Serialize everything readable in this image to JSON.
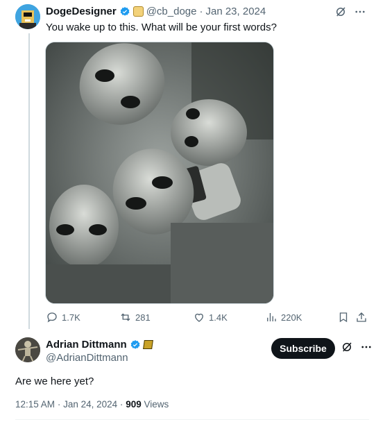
{
  "tweet1": {
    "display_name": "DogeDesigner",
    "handle": "@cb_doge",
    "separator": "·",
    "date": "Jan 23, 2024",
    "text": "You wake up to this. What will be your first words?",
    "stats": {
      "replies": "1.7K",
      "reposts": "281",
      "likes": "1.4K",
      "views": "220K"
    },
    "icons": {
      "verified": "verified-badge-icon",
      "affiliate": "doge-affiliate-badge-icon",
      "grok": "grok-icon",
      "more": "more-icon",
      "reply": "reply-icon",
      "repost": "repost-icon",
      "like": "heart-icon",
      "views": "views-chart-icon",
      "bookmark": "bookmark-icon",
      "share": "share-icon"
    }
  },
  "tweet2": {
    "display_name": "Adrian Dittmann",
    "handle": "@AdrianDittmann",
    "subscribe_label": "Subscribe",
    "text": "Are we here yet?",
    "time": "12:15 AM",
    "separator": "·",
    "date": "Jan 24, 2024",
    "separator2": "·",
    "views_count": "909",
    "views_label": "Views"
  },
  "colors": {
    "text": "#0f1419",
    "muted": "#536471",
    "verified": "#1d9bf0",
    "border": "#cfd9de"
  }
}
